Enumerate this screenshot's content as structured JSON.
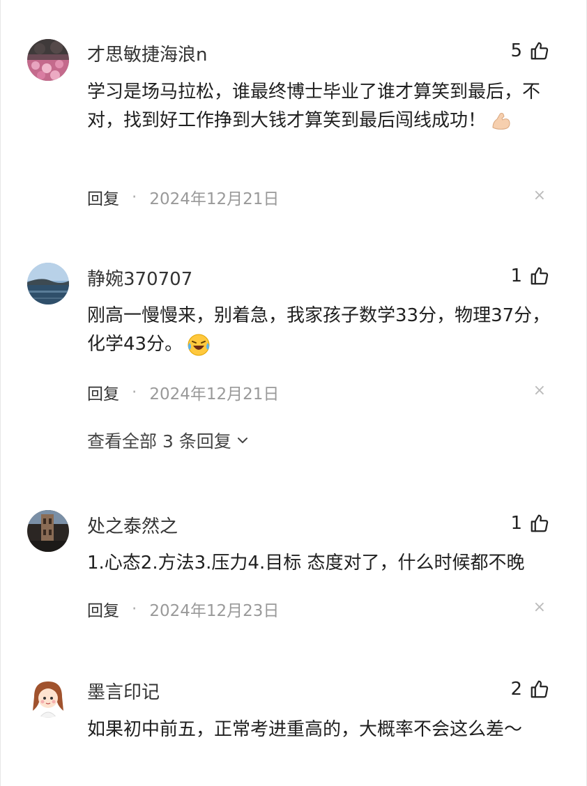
{
  "comments": [
    {
      "username": "才思敏捷海浪n",
      "likes": "5",
      "body": "学习是场马拉松，谁最终博士毕业了谁才算笑到最后，不对，找到好工作挣到大钱才算笑到最后闯线成功！",
      "emoji": "flexed-biceps-emoji",
      "reply_label": "回复",
      "separator": "·",
      "date": "2024年12月21日",
      "close_glyph": "×"
    },
    {
      "username": "静婉370707",
      "likes": "1",
      "body": "刚高一慢慢来，别着急，我家孩子数学33分，物理37分，化学43分。",
      "emoji": "laughing-tears-emoji",
      "reply_label": "回复",
      "separator": "·",
      "date": "2024年12月21日",
      "close_glyph": "×",
      "view_all": "查看全部 3 条回复"
    },
    {
      "username": "处之泰然之",
      "likes": "1",
      "body": "1.心态2.方法3.压力4.目标 态度对了，什么时候都不晚",
      "reply_label": "回复",
      "separator": "·",
      "date": "2024年12月23日",
      "close_glyph": "×"
    },
    {
      "username": "墨言印记",
      "likes": "2",
      "body": "如果初中前五，正常考进重高的，大概率不会这么差～"
    }
  ],
  "icons": {
    "like": "thumbs-up-icon",
    "expand": "chevron-down-icon"
  },
  "colors": {
    "text": "#1f1f1f",
    "meta": "#999999",
    "close": "#bbbbbb"
  }
}
